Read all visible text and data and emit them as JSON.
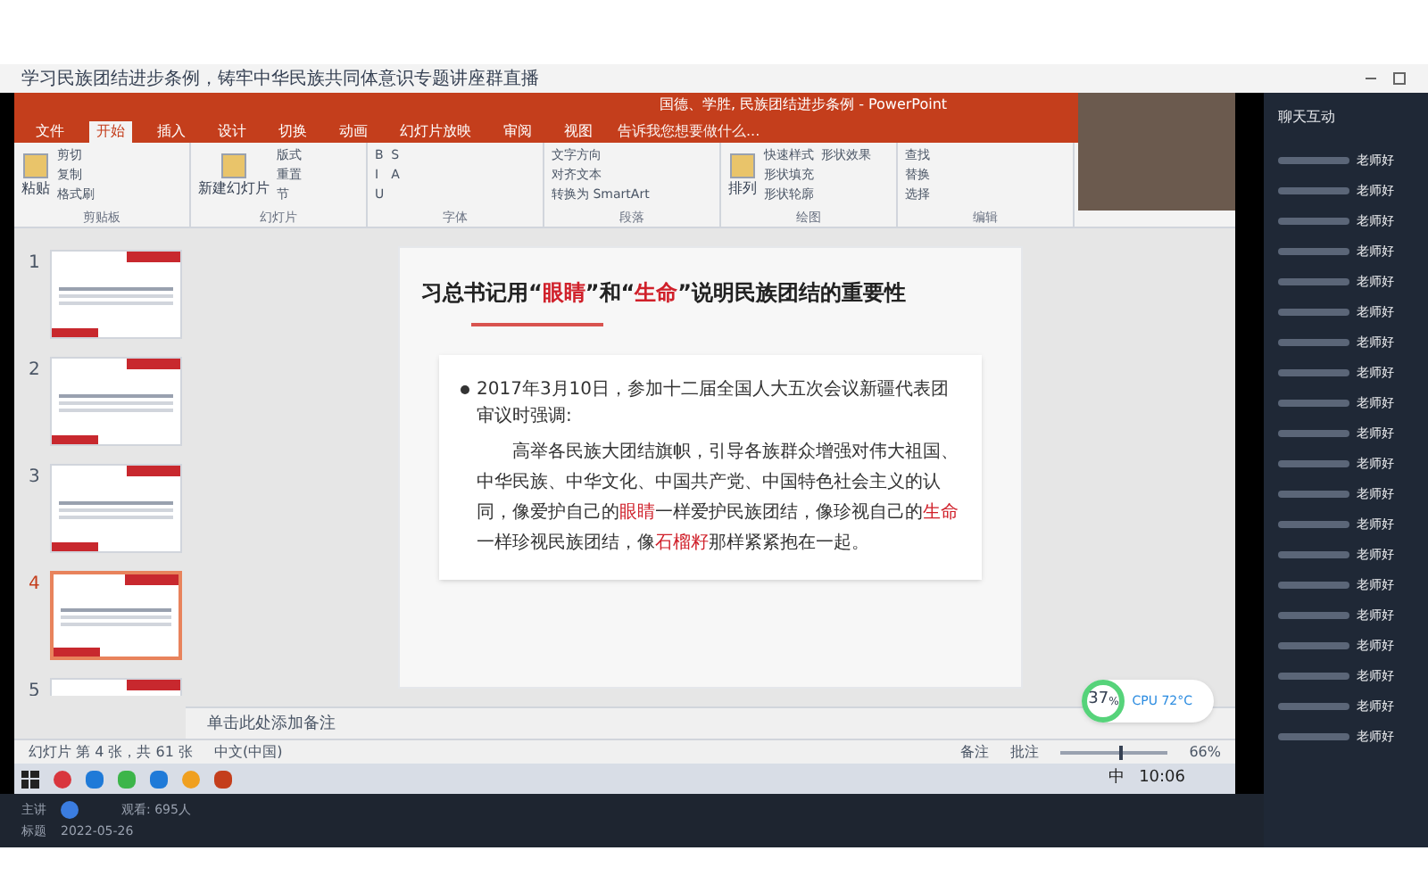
{
  "page_title": "学习民族团结进步条例，铸牢中华民族共同体意识专题讲座群直播",
  "ppt": {
    "title": "国德、学胜, 民族团结进步条例 - PowerPoint",
    "tabs": [
      {
        "label": "文件",
        "selected": false
      },
      {
        "label": "开始",
        "selected": true
      },
      {
        "label": "插入",
        "selected": false
      },
      {
        "label": "设计",
        "selected": false
      },
      {
        "label": "切换",
        "selected": false
      },
      {
        "label": "动画",
        "selected": false
      },
      {
        "label": "幻灯片放映",
        "selected": false
      },
      {
        "label": "审阅",
        "selected": false
      },
      {
        "label": "视图",
        "selected": false
      }
    ],
    "tell_me": "告诉我您想要做什么...",
    "ribbon_groups": [
      {
        "label": "剪贴板",
        "big": "粘贴",
        "items": [
          "剪切",
          "复制",
          "格式刷"
        ]
      },
      {
        "label": "幻灯片",
        "big": "新建幻灯片",
        "items": [
          "版式",
          "重置",
          "节"
        ]
      },
      {
        "label": "字体",
        "items": [
          "B",
          "I",
          "U",
          "S",
          "A"
        ]
      },
      {
        "label": "段落",
        "items": [
          "文字方向",
          "对齐文本",
          "转换为 SmartArt"
        ]
      },
      {
        "label": "绘图",
        "big": "排列",
        "items": [
          "快速样式",
          "形状填充",
          "形状轮廓",
          "形状效果"
        ]
      },
      {
        "label": "编辑",
        "items": [
          "查找",
          "替换",
          "选择"
        ]
      }
    ],
    "thumbnails": [
      {
        "number": "1",
        "selected": false
      },
      {
        "number": "2",
        "selected": false
      },
      {
        "number": "3",
        "selected": false
      },
      {
        "number": "4",
        "selected": true
      },
      {
        "number": "5",
        "selected": false
      }
    ],
    "slide": {
      "title": [
        {
          "text": "习总书记用“",
          "red": false
        },
        {
          "text": "眼睛",
          "red": true
        },
        {
          "text": "”和“",
          "red": false
        },
        {
          "text": "生命",
          "red": true
        },
        {
          "text": "”说明民族团结的重要性",
          "red": false
        }
      ],
      "bullet": "2017年3月10日，参加十二届全国人大五次会议新疆代表团审议时强调:",
      "quote": [
        {
          "text": "高举各民族大团结旗帜，引导各族群众增强对伟大祖国、中华民族、中华文化、中国共产党、中国特色社会主义的认同，像爱护自己的",
          "red": false
        },
        {
          "text": "眼睛",
          "red": true
        },
        {
          "text": "一样爱护民族团结，像珍视自己的",
          "red": false
        },
        {
          "text": "生命",
          "red": true
        },
        {
          "text": "一样珍视民族团结，像",
          "red": false
        },
        {
          "text": "石榴籽",
          "red": true
        },
        {
          "text": "那样紧紧抱在一起。",
          "red": false
        }
      ]
    },
    "notes_placeholder": "单击此处添加备注",
    "status": {
      "slide_info": "幻灯片 第 4 张，共 61 张",
      "language": "中文(中国)",
      "notes": "备注",
      "comments": "批注",
      "zoom": "66%",
      "level": 0.55
    },
    "taskbar": {
      "ime": "中",
      "time": "10:06"
    }
  },
  "monitor": {
    "percent": "37",
    "unit": "%",
    "cpu": "CPU 72°C"
  },
  "chat": {
    "title": "聊天互动",
    "messages": [
      "老师好",
      "老师好",
      "老师好",
      "老师好",
      "老师好",
      "老师好",
      "老师好",
      "老师好",
      "老师好",
      "老师好",
      "老师好",
      "老师好",
      "老师好",
      "老师好",
      "老师好",
      "老师好",
      "老师好",
      "老师好",
      "老师好",
      "老师好"
    ]
  },
  "footer": {
    "host_label": "主讲",
    "viewers": "观看: 695人",
    "title_label": "标题",
    "date": "2022-05-26"
  }
}
